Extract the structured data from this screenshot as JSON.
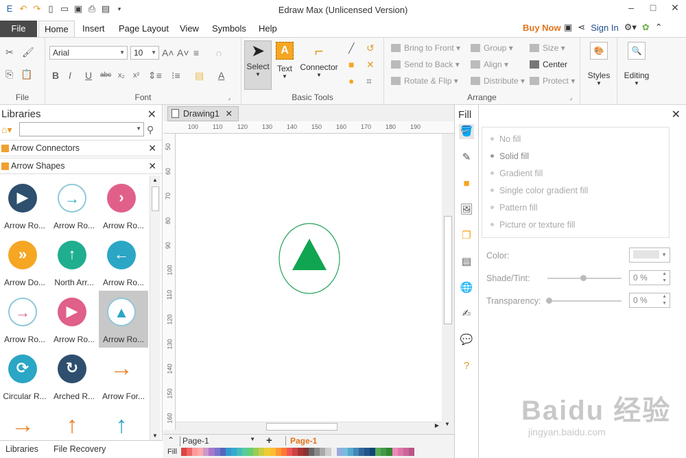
{
  "window": {
    "title": "Edraw Max (Unlicensed Version)"
  },
  "menu": {
    "file": "File",
    "tabs": [
      "Home",
      "Insert",
      "Page Layout",
      "View",
      "Symbols",
      "Help"
    ],
    "buy_now": "Buy Now",
    "sign_in": "Sign In"
  },
  "ribbon": {
    "file_group": "File",
    "font_group": "Font",
    "font_name": "Arial",
    "font_size": "10",
    "basic_tools_group": "Basic Tools",
    "select": "Select",
    "text": "Text",
    "connector": "Connector",
    "arrange_group": "Arrange",
    "bring_to_front": "Bring to Front",
    "send_to_back": "Send to Back",
    "rotate_flip": "Rotate & Flip",
    "group": "Group",
    "align": "Align",
    "distribute": "Distribute",
    "size": "Size",
    "center": "Center",
    "protect": "Protect",
    "styles": "Styles",
    "editing": "Editing"
  },
  "libraries": {
    "title": "Libraries",
    "categories": [
      "Arrow Connectors",
      "Arrow Shapes"
    ],
    "shapes": [
      {
        "label": "Arrow Ro...",
        "color": "#2e4f6e",
        "glyph": "▶"
      },
      {
        "label": "Arrow Ro...",
        "color": "#ffffff",
        "glyph": "→"
      },
      {
        "label": "Arrow Ro...",
        "color": "#e0608a",
        "glyph": "›"
      },
      {
        "label": "Arrow Do...",
        "color": "#f5a623",
        "glyph": "»"
      },
      {
        "label": "North Arr...",
        "color": "#1fae8e",
        "glyph": "↑"
      },
      {
        "label": "Arrow Ro...",
        "color": "#2ba6c4",
        "glyph": "←"
      },
      {
        "label": "Arrow Ro...",
        "color": "#ffffff",
        "glyph": "→"
      },
      {
        "label": "Arrow Ro...",
        "color": "#e0608a",
        "glyph": "▶"
      },
      {
        "label": "Arrow Ro...",
        "color": "#ffffff",
        "glyph": "▲"
      },
      {
        "label": "Circular R...",
        "color": "#2ba6c4",
        "glyph": "⟳"
      },
      {
        "label": "Arched R...",
        "color": "#2e4f6e",
        "glyph": "↻"
      },
      {
        "label": "Arrow For...",
        "color": "#ffffff",
        "glyph": "→"
      },
      {
        "label": "",
        "color": "#ffffff",
        "glyph": "→"
      },
      {
        "label": "",
        "color": "#ffffff",
        "glyph": "↑"
      },
      {
        "label": "",
        "color": "#ffffff",
        "glyph": "↑"
      }
    ],
    "footer_libraries": "Libraries",
    "footer_recovery": "File Recovery"
  },
  "canvas": {
    "tab": "Drawing1",
    "ruler_h": [
      "100",
      "110",
      "120",
      "130",
      "140",
      "150",
      "160",
      "170",
      "180",
      "190"
    ],
    "ruler_v": [
      "50",
      "60",
      "70",
      "80",
      "90",
      "100",
      "110",
      "120",
      "130",
      "140",
      "150",
      "160"
    ],
    "page_select": "Page-1",
    "page_tab": "Page-1",
    "fill_label": "Fill"
  },
  "fill": {
    "title": "Fill",
    "options": [
      "No fill",
      "Solid fill",
      "Gradient fill",
      "Single color gradient fill",
      "Pattern fill",
      "Picture or texture fill"
    ],
    "color_label": "Color:",
    "shade_label": "Shade/Tint:",
    "shade_value": "0 %",
    "transparency_label": "Transparency:",
    "transparency_value": "0 %"
  },
  "watermark": {
    "main": "Baidu 经验",
    "sub": "jingyan.baidu.com"
  }
}
